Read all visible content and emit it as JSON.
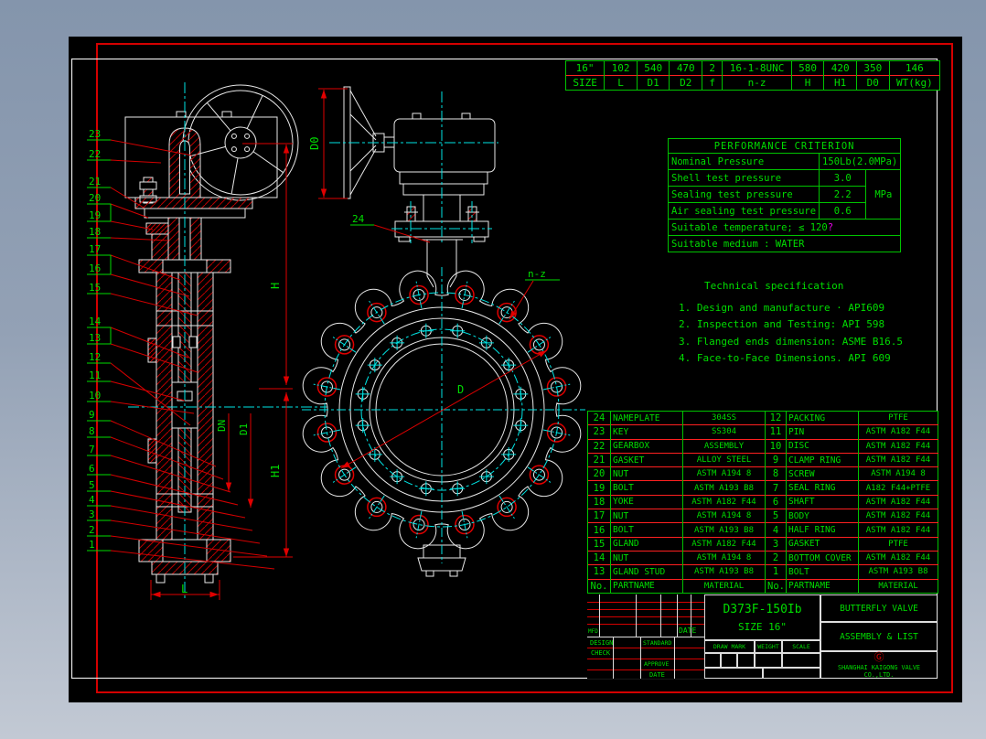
{
  "frame": {
    "accent_red": "#d40000",
    "accent_green": "#00dd00",
    "accent_cyan": "#00e5e5",
    "sheet_white": "#e8e8e8"
  },
  "dim_table": {
    "columns": [
      {
        "value": "16\"",
        "label": "SIZE"
      },
      {
        "value": "102",
        "label": "L"
      },
      {
        "value": "540",
        "label": "D1"
      },
      {
        "value": "470",
        "label": "D2"
      },
      {
        "value": "2",
        "label": "f"
      },
      {
        "value": "16-1-8UNC",
        "label": "n-z"
      },
      {
        "value": "580",
        "label": "H"
      },
      {
        "value": "420",
        "label": "H1"
      },
      {
        "value": "350",
        "label": "D0"
      },
      {
        "value": "146",
        "label": "WT(kg)"
      }
    ]
  },
  "performance": {
    "title": "PERFORMANCE CRITERION",
    "nominal_label": "Nominal Pressure",
    "nominal_value": "150Lb(2.0MPa)",
    "shell_label": "Shell test pressure",
    "shell_value": "3.0",
    "sealing_label": "Sealing test pressure",
    "sealing_value": "2.2",
    "air_label": "Air sealing test pressure",
    "air_value": "0.6",
    "unit": "MPa",
    "temperature": "Suitable temperature; ≤ 120",
    "temperature_mark": "?",
    "medium": "Suitable medium :   WATER"
  },
  "tech_spec": {
    "title": "Technical specification",
    "items": [
      "1. Design and manufacture · API609",
      "2. Inspection and Testing: API 598",
      "3. Flanged ends dimension: ASME B16.5",
      "4. Face-to-Face Dimensions. API 609"
    ]
  },
  "parts_left": {
    "rows": [
      {
        "no": "24",
        "name": "NAMEPLATE",
        "material": "304SS"
      },
      {
        "no": "23",
        "name": "KEY",
        "material": "SS304"
      },
      {
        "no": "22",
        "name": "GEARBOX",
        "material": "ASSEMBLY"
      },
      {
        "no": "21",
        "name": "GASKET",
        "material": "ALLOY STEEL"
      },
      {
        "no": "20",
        "name": "NUT",
        "material": "ASTM A194 8"
      },
      {
        "no": "19",
        "name": "BOLT",
        "material": "ASTM A193 B8"
      },
      {
        "no": "18",
        "name": "YOKE",
        "material": "ASTM A182 F44"
      },
      {
        "no": "17",
        "name": "NUT",
        "material": "ASTM A194 8"
      },
      {
        "no": "16",
        "name": "BOLT",
        "material": "ASTM A193 B8"
      },
      {
        "no": "15",
        "name": "GLAND",
        "material": "ASTM A182 F44"
      },
      {
        "no": "14",
        "name": "NUT",
        "material": "ASTM A194 8"
      },
      {
        "no": "13",
        "name": "GLAND STUD",
        "material": "ASTM A193 B8"
      },
      {
        "no": "No.",
        "name": "PARTNAME",
        "material": "MATERIAL"
      }
    ]
  },
  "parts_right": {
    "rows": [
      {
        "no": "12",
        "name": "PACKING",
        "material": "PTFE"
      },
      {
        "no": "11",
        "name": "PIN",
        "material": "ASTM A182 F44"
      },
      {
        "no": "10",
        "name": "DISC",
        "material": "ASTM A182 F44"
      },
      {
        "no": "9",
        "name": "CLAMP RING",
        "material": "ASTM A182 F44"
      },
      {
        "no": "8",
        "name": "SCREW",
        "material": "ASTM A194 8"
      },
      {
        "no": "7",
        "name": "SEAL RING",
        "material": "A182 F44+PTFE"
      },
      {
        "no": "6",
        "name": "SHAFT",
        "material": "ASTM A182 F44"
      },
      {
        "no": "5",
        "name": "BODY",
        "material": "ASTM A182 F44"
      },
      {
        "no": "4",
        "name": "HALF RING",
        "material": "ASTM A182 F44"
      },
      {
        "no": "3",
        "name": "GASKET",
        "material": "PTFE"
      },
      {
        "no": "2",
        "name": "BOTTOM COVER",
        "material": "ASTM A182 F44"
      },
      {
        "no": "1",
        "name": "BOLT",
        "material": "ASTM A193 B8"
      },
      {
        "no": "No.",
        "name": "PARTNAME",
        "material": "MATERIAL"
      }
    ]
  },
  "title_block": {
    "model": "D373F-150Ib",
    "size": "SIZE 16\"",
    "product": "BUTTERFLY VALVE",
    "sheet": "ASSEMBLY & LIST",
    "company": "SHANGHAI KAIGONG VALVE CO.,LTD.",
    "logo": "Ⓖ",
    "mfd": "MFD",
    "date_top": "DATE",
    "design": "DESIGN",
    "standard": "STANDARD",
    "check": "CHECK",
    "approve": "APPROVE",
    "date_bottom": "DATE",
    "draw_mark": "DRAW MARK",
    "weight": "WEIGHT",
    "scale": "SCALE"
  },
  "drawing": {
    "dims": {
      "h": "H",
      "h1": "H1",
      "dn": "DN",
      "d1": "D1",
      "l": "L",
      "d0": "D0",
      "d": "D",
      "nz": "n-z"
    },
    "balloons": [
      "23",
      "22",
      "21",
      "20",
      "19",
      "18",
      "17",
      "16",
      "15",
      "14",
      "13",
      "12",
      "11",
      "10",
      "9",
      "8",
      "7",
      "6",
      "5",
      "4",
      "3",
      "2",
      "1",
      "24"
    ]
  }
}
